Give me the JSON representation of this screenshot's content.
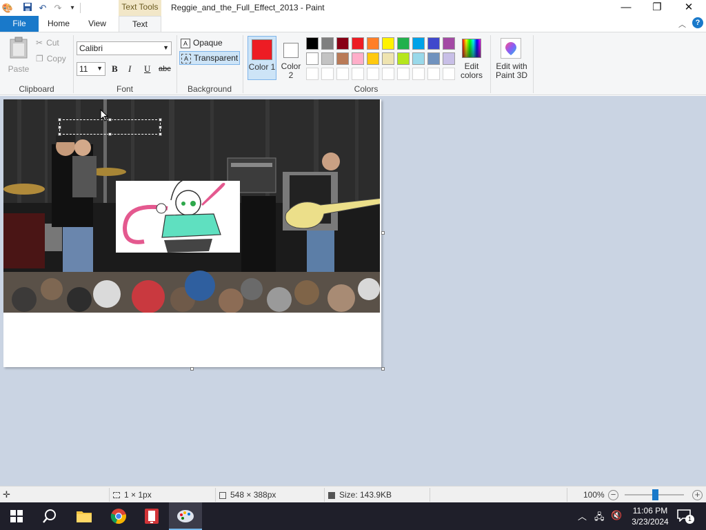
{
  "window": {
    "title": "Reggie_and_the_Full_Effect_2013 - Paint",
    "context_tab_group": "Text Tools"
  },
  "tabs": [
    {
      "label": "File"
    },
    {
      "label": "Home"
    },
    {
      "label": "View"
    },
    {
      "label": "Text"
    }
  ],
  "clipboard": {
    "paste_label": "Paste",
    "cut_label": "Cut",
    "copy_label": "Copy",
    "group_label": "Clipboard"
  },
  "font": {
    "family": "Calibri",
    "size": "11",
    "bold": "B",
    "italic": "I",
    "underline": "U",
    "strikethrough": "abc",
    "group_label": "Font"
  },
  "background": {
    "opaque_label": "Opaque",
    "transparent_label": "Transparent",
    "group_label": "Background"
  },
  "colors": {
    "color1_label": "Color 1",
    "color2_label": "Color 2",
    "color1_value": "#ed1c24",
    "color2_value": "#ffffff",
    "edit_colors_label": "Edit colors",
    "edit_3d_label": "Edit with Paint 3D",
    "group_label": "Colors",
    "palette_row1": [
      "#000000",
      "#7f7f7f",
      "#880015",
      "#ed1c24",
      "#ff7f27",
      "#fff200",
      "#22b14c",
      "#00a2e8",
      "#3f48cc",
      "#a349a4"
    ],
    "palette_row2": [
      "#ffffff",
      "#c3c3c3",
      "#b97a57",
      "#ffaec9",
      "#ffc90e",
      "#efe4b0",
      "#b5e61d",
      "#99d9ea",
      "#7092be",
      "#c8bfe7"
    ]
  },
  "status": {
    "selection": "1 × 1px",
    "image_size": "548 × 388px",
    "file_size": "Size: 143.9KB",
    "zoom": "100%"
  },
  "taskbar": {
    "time": "11:06 PM",
    "date": "3/23/2024",
    "notification_count": "1"
  }
}
